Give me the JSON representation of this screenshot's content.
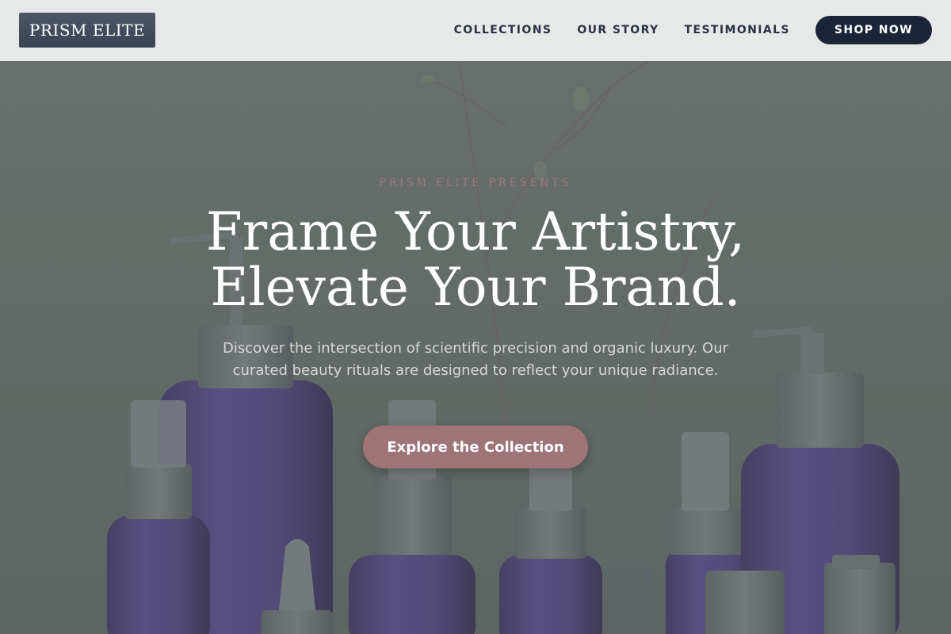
{
  "brand": {
    "logo_text": "PRISM ELITE"
  },
  "nav": {
    "links": [
      {
        "label": "COLLECTIONS"
      },
      {
        "label": "OUR STORY"
      },
      {
        "label": "TESTIMONIALS"
      }
    ],
    "shop_button": "SHOP NOW"
  },
  "hero": {
    "eyebrow": "PRISM ELITE PRESENTS",
    "headline_line1": "Frame Your Artistry,",
    "headline_line2": "Elevate Your Brand.",
    "subtext": "Discover the intersection of scientific precision and organic luxury. Our curated beauty rituals are designed to reflect your unique radiance.",
    "cta_label": "Explore the Collection",
    "background_image": "purple glass skincare bottles with pump and spray caps"
  },
  "colors": {
    "nav_background": "#ecedee",
    "logo_background": "#3f4658",
    "nav_text": "#2b3344",
    "shop_button": "#1d2438",
    "eyebrow": "#9b7a7c",
    "cta_button": "#9e7477",
    "overlay": "#646b68",
    "bottle_purple": "#4a3e7a"
  }
}
